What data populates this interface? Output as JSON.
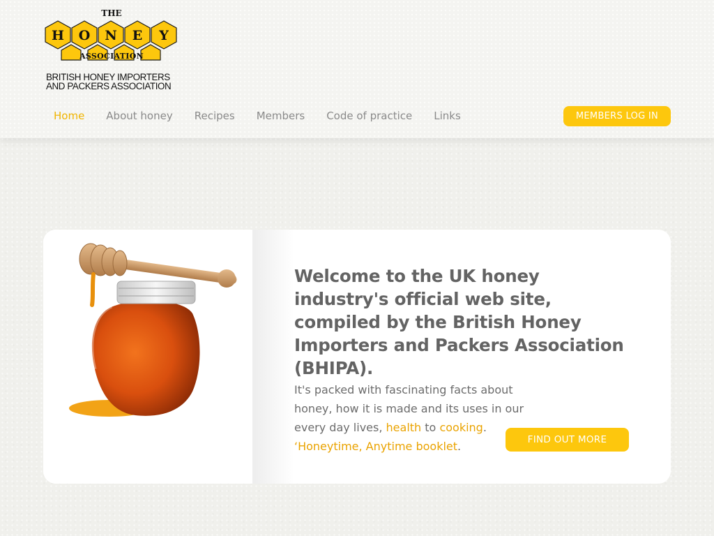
{
  "logo": {
    "the": "THE",
    "letters": [
      "H",
      "O",
      "N",
      "E",
      "Y"
    ],
    "association": "ASSOCIATION",
    "subtitle_line1": "BRITISH HONEY IMPORTERS",
    "subtitle_line2": "AND PACKERS ASSOCIATION"
  },
  "nav": {
    "items": [
      {
        "label": "Home",
        "active": true
      },
      {
        "label": "About honey",
        "active": false
      },
      {
        "label": "Recipes",
        "active": false
      },
      {
        "label": "Members",
        "active": false
      },
      {
        "label": "Code of practice",
        "active": false
      },
      {
        "label": "Links",
        "active": false
      }
    ]
  },
  "login_button": "MEMBERS LOG IN",
  "welcome": {
    "title": "Welcome to the UK honey industry's official web site, compiled by the British Honey Importers and Packers Association (BHIPA).",
    "body_text": "It's packed with fascinating facts about honey, how it is made and its uses in our every day lives,",
    "link_health": "health",
    "connector": "to",
    "link_cooking": "cooking",
    "period": ".",
    "link_booklet": "‘Honeytime, Anytime booklet",
    "period2": ".",
    "button": "FIND OUT MORE"
  },
  "colors": {
    "accent": "#fdc70d",
    "link": "#eaa300",
    "nav_active": "#f0b400",
    "nav_inactive": "#8a8a8a",
    "heading": "#636363"
  },
  "icons": {
    "hero_image": "honey-jar-with-dipper"
  }
}
